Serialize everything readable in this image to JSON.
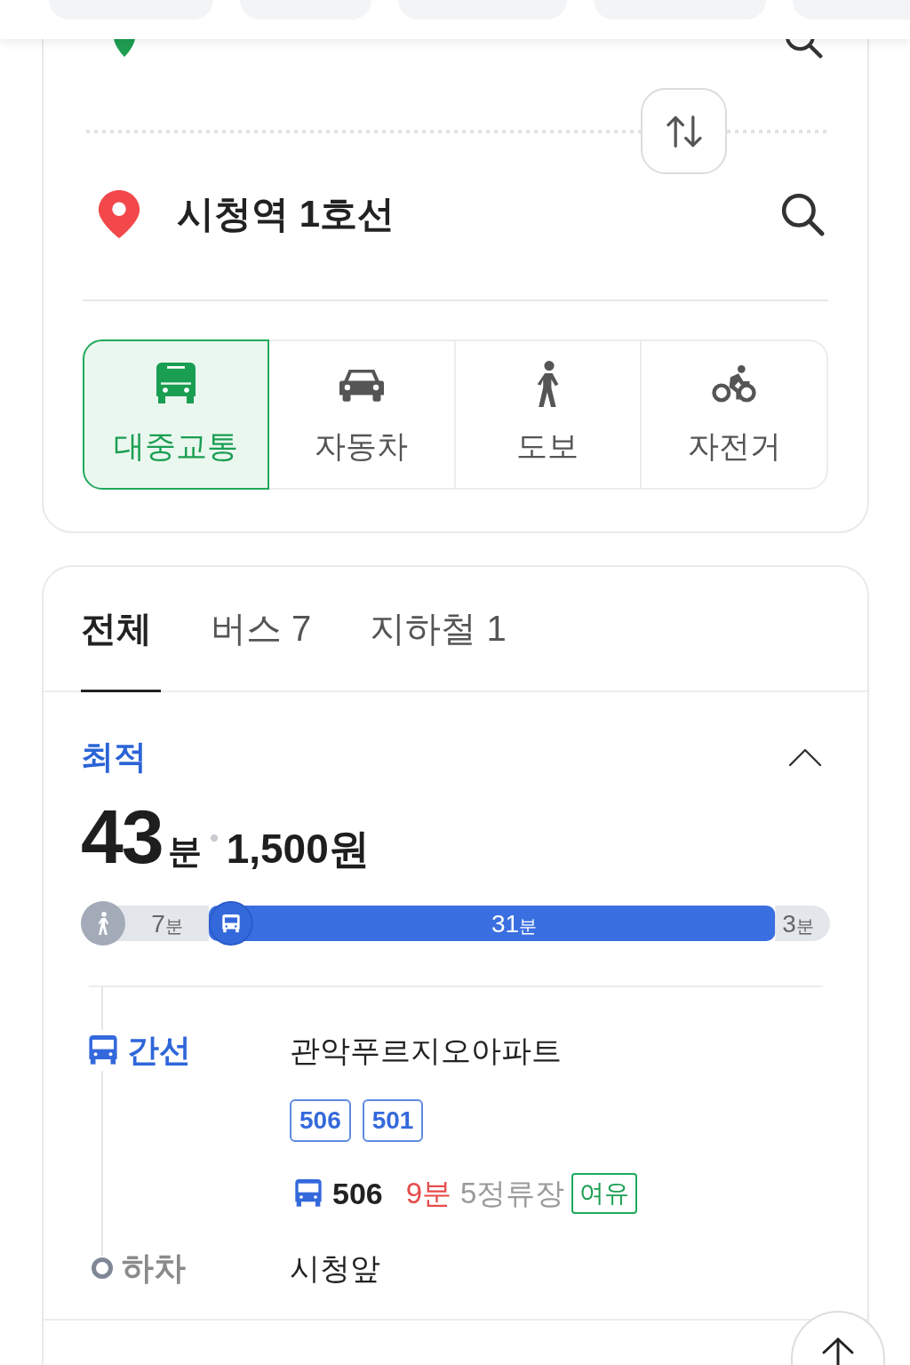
{
  "route_card": {
    "destination": {
      "name": "시청역 1호선"
    },
    "modes": [
      {
        "kind": "transit",
        "label": "대중교통",
        "selected": true
      },
      {
        "kind": "car",
        "label": "자동차",
        "selected": false
      },
      {
        "kind": "walk",
        "label": "도보",
        "selected": false
      },
      {
        "kind": "bike",
        "label": "자전거",
        "selected": false
      }
    ]
  },
  "results": {
    "tabs": [
      {
        "label": "전체",
        "selected": true
      },
      {
        "label": "버스 7",
        "selected": false
      },
      {
        "label": "지하철 1",
        "selected": false
      }
    ],
    "route": {
      "tag": "최적",
      "expanded": true,
      "duration": {
        "value": "43",
        "unit": "분"
      },
      "fare": "1,500원",
      "timeline": {
        "legs": [
          {
            "kind": "walk",
            "icon": true,
            "unit": "분"
          },
          {
            "kind": "bus",
            "icon": true,
            "unit": "분"
          },
          {
            "kind": "walk",
            "icon": false,
            "unit": "분"
          }
        ],
        "chart_data": {
          "type": "bar",
          "orientation": "horizontal",
          "stacked": true,
          "data_labels": true,
          "xlim": [
            0,
            41
          ],
          "series": [
            {
              "color": "#e3e6eb",
              "values": [
                7
              ]
            },
            {
              "color": "#3a6fe1",
              "values": [
                31
              ]
            },
            {
              "color": "#e3e6eb",
              "values": [
                3
              ]
            }
          ]
        }
      },
      "steps": [
        {
          "kind": "bus",
          "label": "간선",
          "stop": "관악푸르지오아파트",
          "lines": [
            "506",
            "501"
          ],
          "arrival": {
            "line": "506",
            "wait": "9분",
            "stops": "5정류장",
            "crowding": "여유"
          }
        },
        {
          "kind": "alight",
          "label": "하차",
          "stop": "시청앞"
        }
      ]
    }
  }
}
